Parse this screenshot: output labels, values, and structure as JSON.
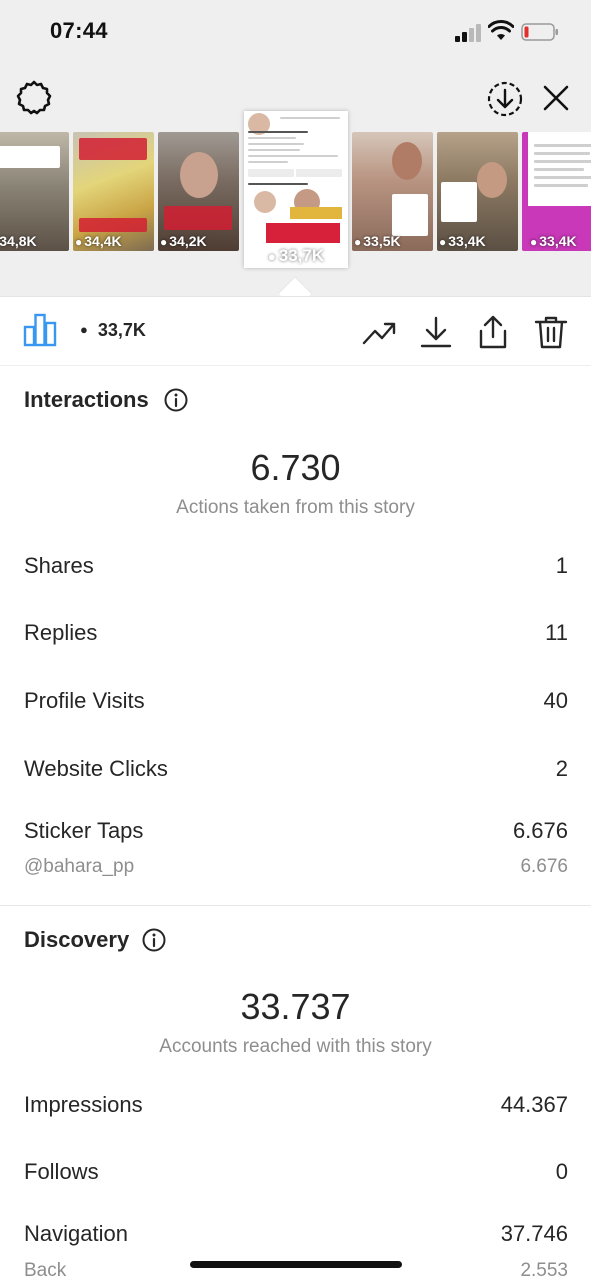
{
  "status_bar": {
    "time": "07:44"
  },
  "thumbnails": [
    {
      "views": "34,8K"
    },
    {
      "views": "34,4K"
    },
    {
      "views": "34,2K"
    },
    {
      "views": "33,7K",
      "selected": true
    },
    {
      "views": "33,5K"
    },
    {
      "views": "33,4K"
    },
    {
      "views": "33,4K"
    }
  ],
  "action_bar": {
    "views": "33,7K"
  },
  "interactions": {
    "title": "Interactions",
    "total": "6.730",
    "caption": "Actions taken from this story",
    "rows": [
      {
        "label": "Shares",
        "value": "1"
      },
      {
        "label": "Replies",
        "value": "11"
      },
      {
        "label": "Profile Visits",
        "value": "40"
      },
      {
        "label": "Website Clicks",
        "value": "2"
      },
      {
        "label": "Sticker Taps",
        "value": "6.676"
      }
    ],
    "sticker_sub": {
      "label": "@bahara_pp",
      "value": "6.676"
    }
  },
  "discovery": {
    "title": "Discovery",
    "total": "33.737",
    "caption": "Accounts reached with this story",
    "rows": [
      {
        "label": "Impressions",
        "value": "44.367"
      },
      {
        "label": "Follows",
        "value": "0"
      },
      {
        "label": "Navigation",
        "value": "37.746"
      }
    ],
    "navigation_sub": {
      "label": "Back",
      "value": "2.553"
    }
  },
  "colors": {
    "accent": "#3897f0",
    "text": "#262626",
    "muted": "#8e8e8e",
    "top_bg": "#efefef"
  }
}
